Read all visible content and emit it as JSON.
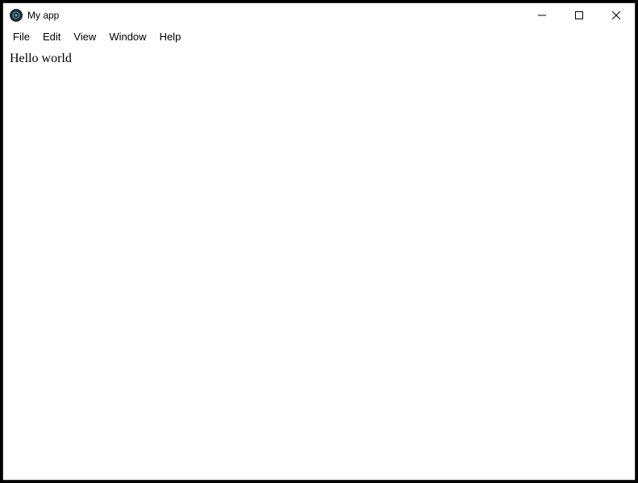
{
  "window": {
    "title": "My app"
  },
  "menubar": {
    "items": [
      "File",
      "Edit",
      "View",
      "Window",
      "Help"
    ]
  },
  "content": {
    "text": "Hello world"
  }
}
